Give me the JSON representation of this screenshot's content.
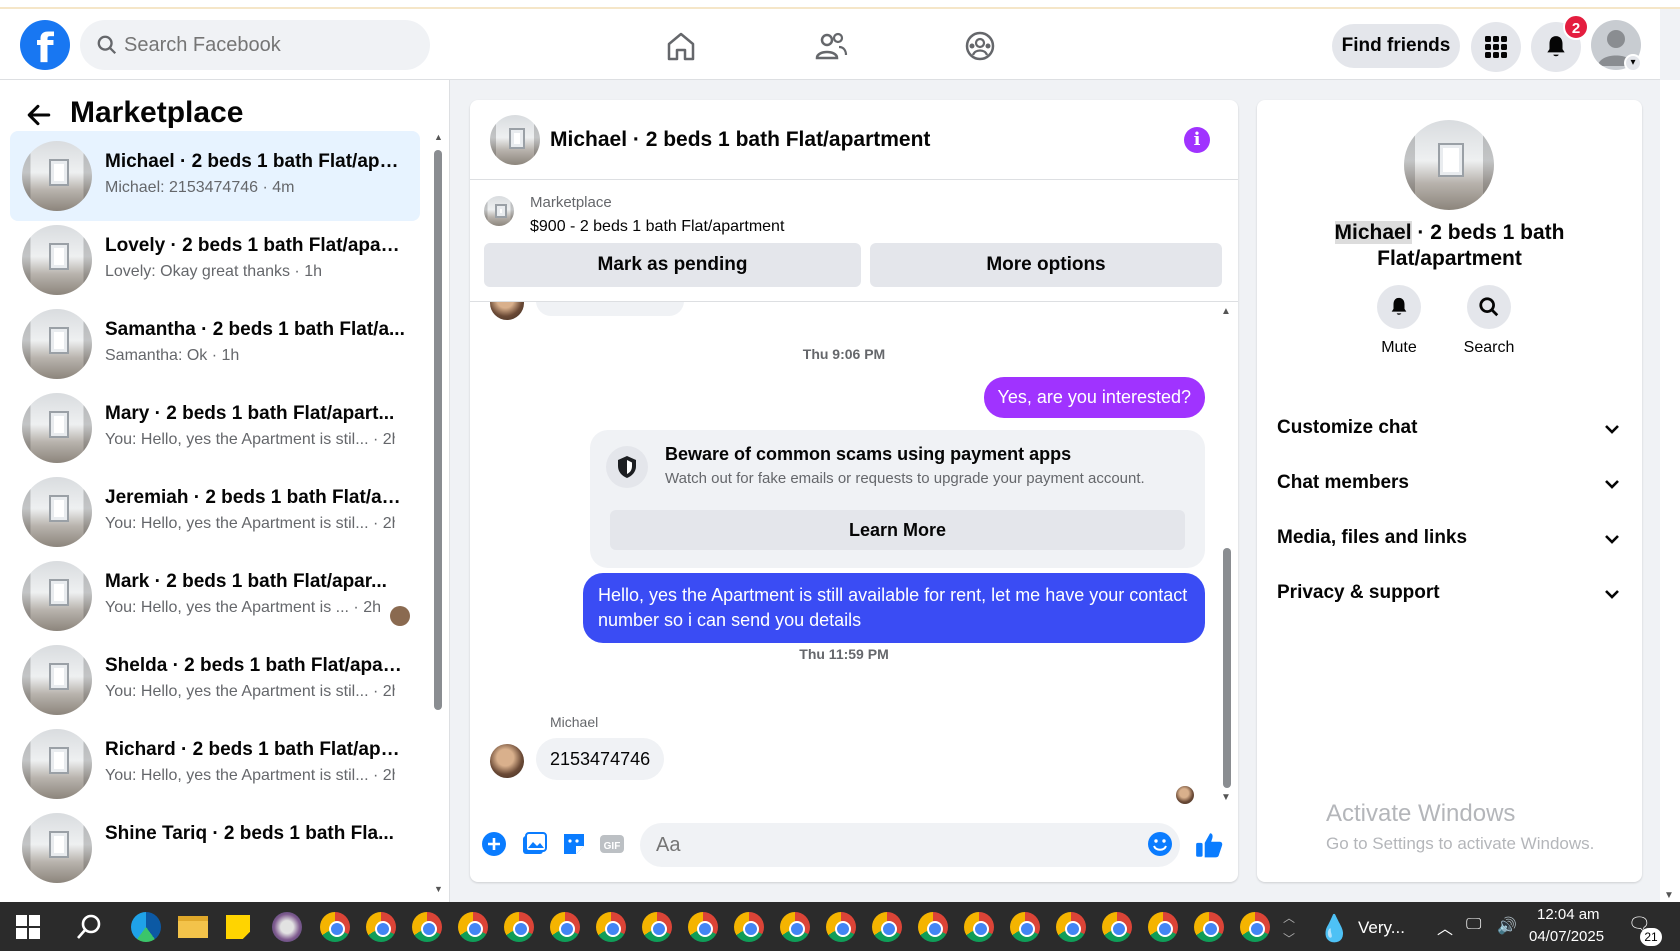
{
  "header": {
    "logo": "f",
    "search_placeholder": "Search Facebook",
    "find_friends": "Find friends",
    "notif_count": "2"
  },
  "left": {
    "title": "Marketplace",
    "conversations": [
      {
        "name": "Michael · 2 beds 1 bath Flat/apa...",
        "snippet": "Michael: 2153474746 · 4m"
      },
      {
        "name": "Lovely · 2 beds 1 bath Flat/apart...",
        "snippet": "Lovely: Okay great thanks · 1h"
      },
      {
        "name": "Samantha · 2 beds 1 bath Flat/a...",
        "snippet": "Samantha: Ok · 1h"
      },
      {
        "name": "Mary · 2 beds 1 bath Flat/apart...",
        "snippet": "You: Hello, yes the Apartment is stil... · 2h"
      },
      {
        "name": "Jeremiah · 2 beds 1 bath Flat/ap...",
        "snippet": "You: Hello, yes the Apartment is stil... · 2h"
      },
      {
        "name": "Mark · 2 beds 1 bath Flat/apar...",
        "snippet": "You: Hello, yes the Apartment is ... · 2h"
      },
      {
        "name": "Shelda · 2 beds 1 bath Flat/apart...",
        "snippet": "You: Hello, yes the Apartment is stil... · 2h"
      },
      {
        "name": "Richard · 2 beds 1 bath Flat/apar...",
        "snippet": "You: Hello, yes the Apartment is stil... · 2h"
      },
      {
        "name": "Shine Tariq · 2 beds 1 bath Fla...",
        "snippet": ""
      }
    ]
  },
  "chat": {
    "title": "Michael · 2 beds 1 bath Flat/apartment",
    "listing_source": "Marketplace",
    "listing_price": "$900 - 2 beds 1 bath Flat/apartment",
    "mark_pending": "Mark as pending",
    "more_options": "More options",
    "ts1": "Thu 9:06 PM",
    "out1": "Yes, are you interested?",
    "scam_title": "Beware of common scams using payment apps",
    "scam_desc": "Watch out for fake emails or requests to upgrade your payment account.",
    "learn_more": "Learn More",
    "out2": "Hello, yes the Apartment is still available for rent, let me have your contact number so i can send you details",
    "ts2": "Thu 11:59 PM",
    "sender": "Michael",
    "in1": "2153474746",
    "composer_placeholder": "Aa"
  },
  "right": {
    "name_hl": "Michael",
    "name_rest": " · 2 beds 1 bath Flat/apartment",
    "mute": "Mute",
    "search": "Search",
    "rows": [
      "Customize chat",
      "Chat members",
      "Media, files and links",
      "Privacy & support"
    ],
    "wm1": "Activate Windows",
    "wm2": "Go to Settings to activate Windows."
  },
  "taskbar": {
    "weather": "Very...",
    "time": "12:04 am",
    "date": "04/07/2025",
    "notif": "21"
  },
  "colors": {
    "brand": "#1877f2",
    "accent": "#a033ff",
    "bubble2": "#3a4cf4"
  }
}
